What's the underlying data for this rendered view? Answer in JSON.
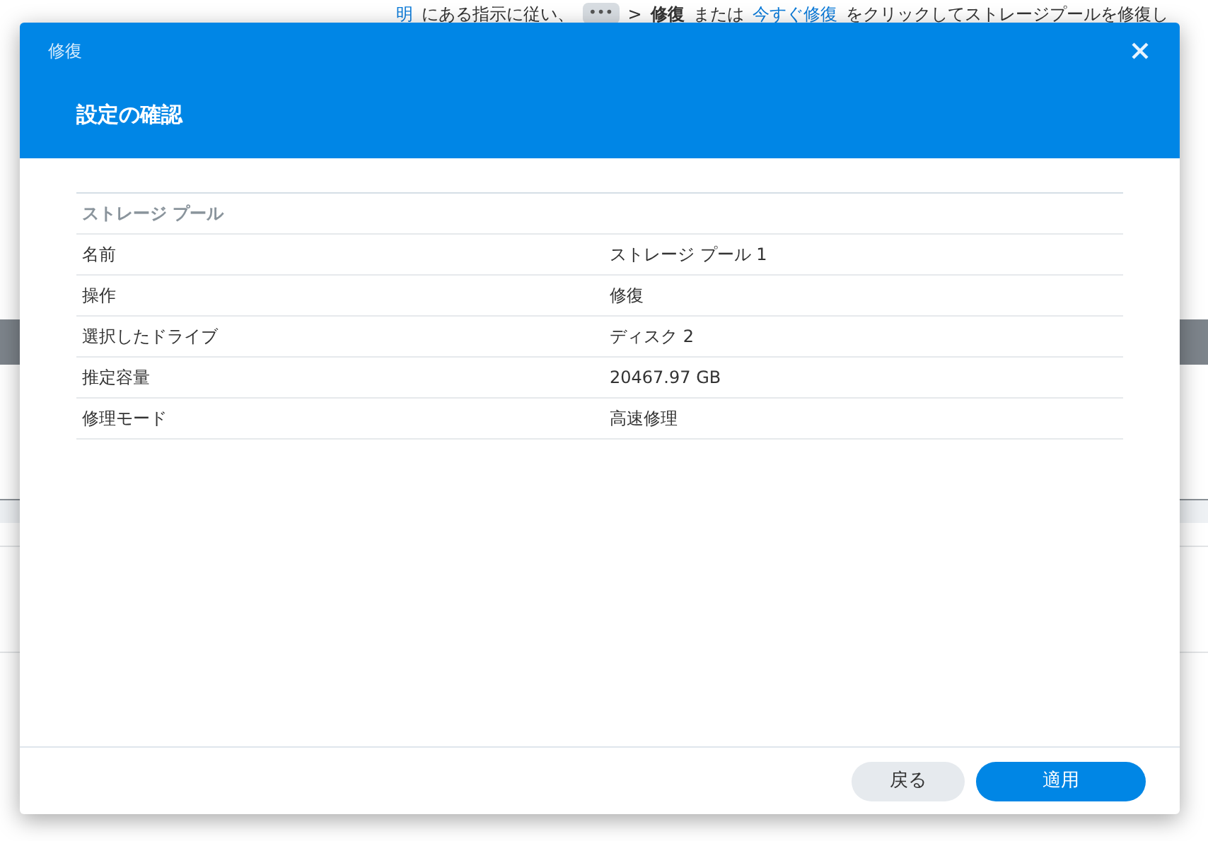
{
  "background": {
    "instruction": [
      {
        "kind": "link",
        "text": "明"
      },
      {
        "kind": "text",
        "text": "にある指示に従い、"
      },
      {
        "kind": "chip",
        "text": "•••"
      },
      {
        "kind": "text",
        "text": ">"
      },
      {
        "kind": "bold",
        "text": "修復"
      },
      {
        "kind": "text",
        "text": "または"
      },
      {
        "kind": "link",
        "text": "今すぐ修復"
      },
      {
        "kind": "text",
        "text": "をクリックしてストレージプールを修復し"
      }
    ]
  },
  "dialog": {
    "title": "修復",
    "heading": "設定の確認",
    "table": {
      "section": "ストレージ プール",
      "rows": [
        {
          "label": "名前",
          "value": "ストレージ プール 1"
        },
        {
          "label": "操作",
          "value": "修復"
        },
        {
          "label": "選択したドライブ",
          "value": "ディスク 2"
        },
        {
          "label": "推定容量",
          "value": "20467.97 GB"
        },
        {
          "label": "修理モード",
          "value": "高速修理"
        }
      ]
    },
    "buttons": [
      {
        "kind": "secondary",
        "label": "戻る"
      },
      {
        "kind": "primary",
        "label": "適用"
      }
    ]
  }
}
